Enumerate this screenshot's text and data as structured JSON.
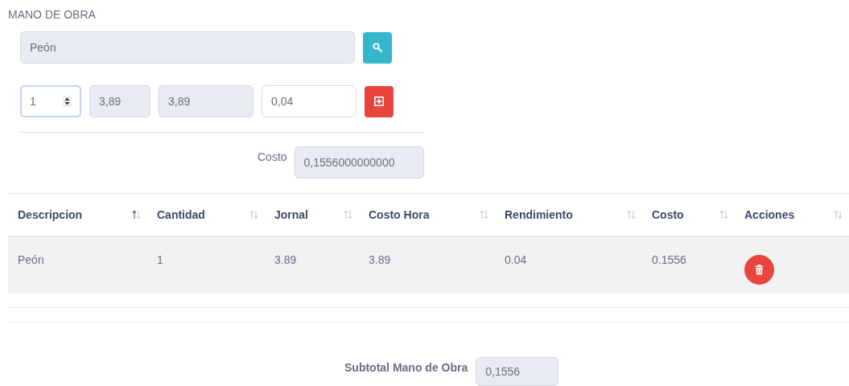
{
  "section_title": "MANO DE OBRA",
  "search": {
    "value": "Peón"
  },
  "inputs": [
    {
      "kind": "spinner",
      "value": "1",
      "disabled": false
    },
    {
      "kind": "text",
      "value": "3,89",
      "disabled": true
    },
    {
      "kind": "text",
      "value": "3,89",
      "disabled": true
    },
    {
      "kind": "text",
      "value": "0,04",
      "disabled": false
    }
  ],
  "costo": {
    "label": "Costo",
    "value": "0,1556000000000"
  },
  "table": {
    "columns": [
      {
        "label": "Descripcion",
        "sorted": true
      },
      {
        "label": "Cantidad",
        "sorted": false
      },
      {
        "label": "Jornal",
        "sorted": false
      },
      {
        "label": "Costo Hora",
        "sorted": false
      },
      {
        "label": "Rendimiento",
        "sorted": false
      },
      {
        "label": "Costo",
        "sorted": false
      },
      {
        "label": "Acciones",
        "sorted": false
      }
    ],
    "rows": [
      {
        "cells": [
          "Peón",
          "1",
          "3.89",
          "3.89",
          "0.04",
          "0.1556"
        ]
      }
    ]
  },
  "subtotal": {
    "label": "Subtotal Mano de Obra",
    "value": "0,1556"
  }
}
